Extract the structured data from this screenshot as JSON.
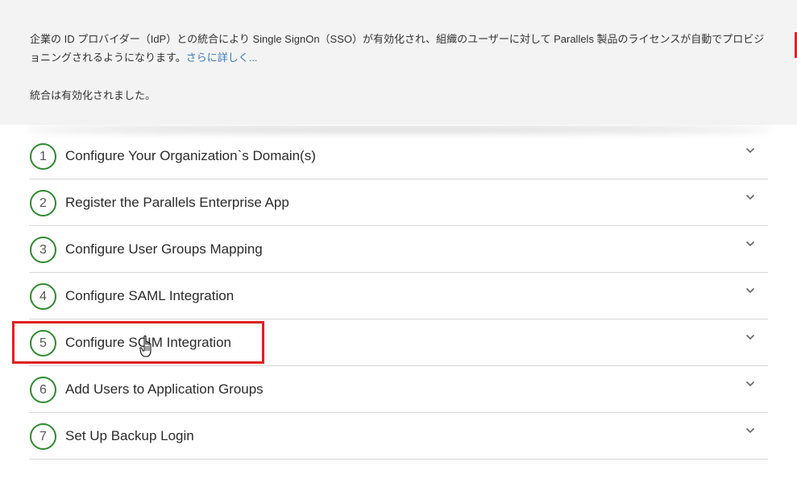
{
  "intro": {
    "description": "企業の ID プロバイダー（IdP）との統合により Single SignOn（SSO）が有効化され、組織のユーザーに対して Parallels 製品のライセンスが自動でプロビジョニングされるようになります。",
    "learn_more": "さらに詳しく...",
    "status": "統合は有効化されました。"
  },
  "steps": [
    {
      "number": "1",
      "title": "Configure Your Organization`s Domain(s)"
    },
    {
      "number": "2",
      "title": "Register the Parallels Enterprise App"
    },
    {
      "number": "3",
      "title": "Configure User Groups Mapping"
    },
    {
      "number": "4",
      "title": "Configure SAML Integration"
    },
    {
      "number": "5",
      "title": "Configure SCIM Integration"
    },
    {
      "number": "6",
      "title": "Add Users to Application Groups"
    },
    {
      "number": "7",
      "title": "Set Up Backup Login"
    }
  ],
  "icons": {
    "expand": "chevron-down-icon",
    "cursor": "hand-pointer-icon"
  },
  "colors": {
    "step_circle": "#2e8b2e",
    "link": "#3a7bbf",
    "highlight": "#e0201e"
  }
}
